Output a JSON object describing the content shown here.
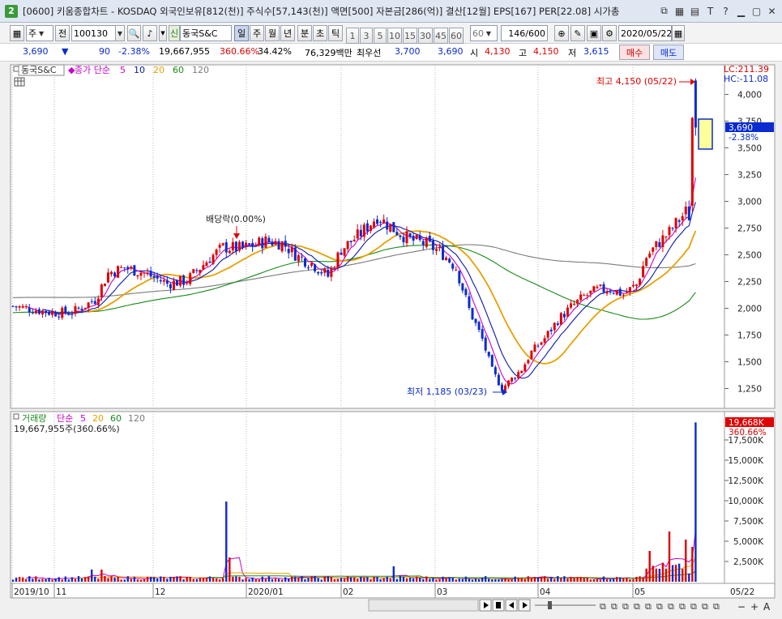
{
  "window": {
    "title": "[0600] 키움종합차트 - KOSDAQ 외국인보유[812(천)] 주식수[57,143(천)] 액면[500] 자본금[286(억)] 결산[12월] EPS[167] PER[22.08] 시가총",
    "app_number": "2"
  },
  "toolbar": {
    "period_label": "주",
    "prev_label": "전",
    "code": "100130",
    "credit_label": "신",
    "stock_name": "동국S&C",
    "tf_day": "일",
    "tf_week": "주",
    "tf_month": "월",
    "tf_year": "년",
    "tf_minute": "분",
    "tf_second": "초",
    "tf_tick": "틱",
    "interval_buttons": [
      "1",
      "3",
      "5",
      "10",
      "15",
      "30",
      "45",
      "60"
    ],
    "interval_select": "60",
    "count": "146/600",
    "date": "2020/05/22"
  },
  "quote": {
    "price": "3,690",
    "change": "90",
    "change_pct": "-2.38%",
    "volume": "19,667,955",
    "volume_ratio": "360.66%",
    "turnover": "34.42%",
    "amount": "76,329백만",
    "best_label": "최우선",
    "best_ask": "3,700",
    "best_bid": "3,690",
    "open_label": "시",
    "open": "4,130",
    "high_label": "고",
    "high": "4,150",
    "low_label": "저",
    "low": "3,615",
    "buy_label": "매수",
    "sell_label": "매도"
  },
  "price_panel": {
    "legend_name": "동국S&C",
    "legend_ma_label": "종가 단순",
    "legend_ma": [
      {
        "label": "5",
        "color": "#c800c8"
      },
      {
        "label": "10",
        "color": "#0a1aa8"
      },
      {
        "label": "20",
        "color": "#e8a000"
      },
      {
        "label": "60",
        "color": "#1a8a1a"
      },
      {
        "label": "120",
        "color": "#7a7a7a"
      }
    ],
    "lc_label": "LC:211.39",
    "hc_label": "HC:-11.08",
    "y_ticks": [
      "4,000",
      "3,750",
      "3,500",
      "3,250",
      "3,000",
      "2,750",
      "2,500",
      "2,250",
      "2,000",
      "1,750",
      "1,500",
      "1,250"
    ],
    "current_price_label": "3,690",
    "current_pct_label": "-2.38%",
    "high_annotation": "최고 4,150 (05/22)",
    "low_annotation": "최저 1,185 (03/23)",
    "dividend_annotation": "배당락(0.00%)"
  },
  "volume_panel": {
    "legend_name": "거래량",
    "legend_ma_label": "단순",
    "legend_ma": [
      {
        "label": "5",
        "color": "#c800c8"
      },
      {
        "label": "20",
        "color": "#e8a000"
      },
      {
        "label": "60",
        "color": "#1a8a1a"
      },
      {
        "label": "120",
        "color": "#7a7a7a"
      }
    ],
    "value_label": "19,667,955주(360.66%)",
    "y_ticks": [
      "17,500K",
      "15,000K",
      "12,500K",
      "10,000K",
      "7,500K",
      "5,000K",
      "2,500K"
    ],
    "current_label": "19,668K",
    "current_pct": "360.66%"
  },
  "x_axis": {
    "labels": [
      "2019/10",
      "11",
      "12",
      "2020/01",
      "02",
      "03",
      "04",
      "05"
    ],
    "end_label": "05/22"
  },
  "colors": {
    "up": "#e00000",
    "down": "#0a2bd0",
    "ma5": "#c800c8",
    "ma10": "#0a1aa8",
    "ma20": "#e8a000",
    "ma60": "#1a8a1a",
    "ma120": "#7a7a7a"
  }
}
